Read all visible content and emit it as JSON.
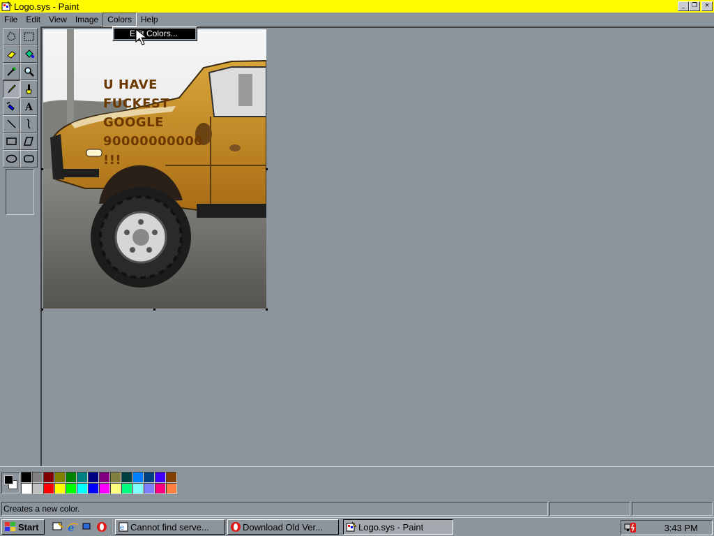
{
  "window": {
    "title": "Logo.sys - Paint",
    "buttons": [
      "_",
      "❐",
      "×"
    ]
  },
  "menu": [
    {
      "label": "File",
      "active": false
    },
    {
      "label": "Edit",
      "active": false
    },
    {
      "label": "View",
      "active": false
    },
    {
      "label": "Image",
      "active": false
    },
    {
      "label": "Colors",
      "active": true
    },
    {
      "label": "Help",
      "active": false
    }
  ],
  "dropdown": {
    "item": "Edit Colors..."
  },
  "tools": [
    {
      "name": "free-select-icon"
    },
    {
      "name": "rect-select-icon"
    },
    {
      "name": "eraser-icon"
    },
    {
      "name": "fill-icon"
    },
    {
      "name": "color-picker-icon"
    },
    {
      "name": "magnifier-icon"
    },
    {
      "name": "pencil-icon",
      "pressed": true
    },
    {
      "name": "brush-icon"
    },
    {
      "name": "airbrush-icon"
    },
    {
      "name": "text-icon"
    },
    {
      "name": "line-icon"
    },
    {
      "name": "curve-icon"
    },
    {
      "name": "rectangle-icon"
    },
    {
      "name": "polygon-icon"
    },
    {
      "name": "ellipse-icon"
    },
    {
      "name": "rounded-rect-icon"
    }
  ],
  "canvas": {
    "text_lines": [
      "U HAVE",
      "FUCKEST",
      "GOOGLE",
      "90000000000",
      "!!!"
    ]
  },
  "palette": {
    "top": [
      "#000000",
      "#808080",
      "#800000",
      "#808000",
      "#008000",
      "#008080",
      "#000080",
      "#800080",
      "#808040",
      "#004040",
      "#0080ff",
      "#004080",
      "#4000ff",
      "#804000"
    ],
    "bottom": [
      "#ffffff",
      "#c0c0c0",
      "#ff0000",
      "#ffff00",
      "#00ff00",
      "#00ffff",
      "#0000ff",
      "#ff00ff",
      "#ffff80",
      "#00ff80",
      "#80ffff",
      "#8080ff",
      "#ff0080",
      "#ff8040"
    ]
  },
  "status": {
    "text": "Creates a new color."
  },
  "taskbar": {
    "start_label": "Start",
    "tasks": [
      {
        "label": "Cannot find serve...",
        "active": false
      },
      {
        "label": "Download Old Ver...",
        "active": false
      },
      {
        "label": "Logo.sys - Paint",
        "active": true
      }
    ],
    "clock": "3:43 PM"
  }
}
